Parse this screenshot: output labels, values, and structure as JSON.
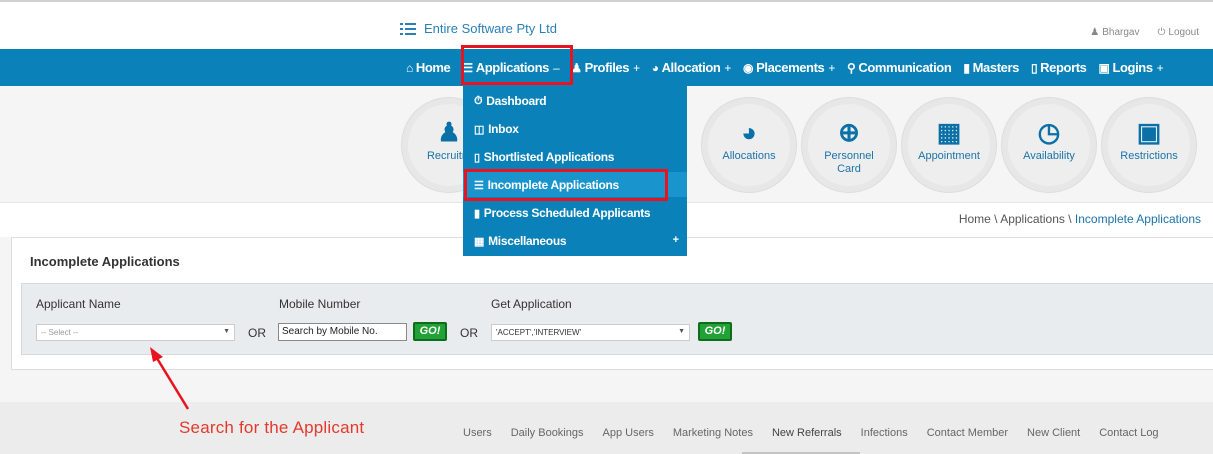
{
  "header": {
    "brand": "Entire Software Pty Ltd",
    "user": "Bhargav",
    "logout": "Logout"
  },
  "nav": {
    "items": [
      {
        "label": "Home",
        "icon": "home-icon",
        "sign": ""
      },
      {
        "label": "Applications",
        "icon": "list-icon",
        "sign": "–"
      },
      {
        "label": "Profiles",
        "icon": "user-icon",
        "sign": "+"
      },
      {
        "label": "Allocation",
        "icon": "pie-chart-icon",
        "sign": "+"
      },
      {
        "label": "Placements",
        "icon": "globe-icon",
        "sign": "+"
      },
      {
        "label": "Communication",
        "icon": "chat-icon",
        "sign": ""
      },
      {
        "label": "Masters",
        "icon": "folder-icon",
        "sign": ""
      },
      {
        "label": "Reports",
        "icon": "folder-open-icon",
        "sign": ""
      },
      {
        "label": "Logins",
        "icon": "lock-icon",
        "sign": "+"
      }
    ]
  },
  "dropdown": {
    "items": [
      {
        "label": "Dashboard",
        "icon": "dashboard-icon"
      },
      {
        "label": "Inbox",
        "icon": "inbox-icon"
      },
      {
        "label": "Shortlisted Applications",
        "icon": "folder-open-icon"
      },
      {
        "label": "Incomplete Applications",
        "icon": "list-icon"
      },
      {
        "label": "Process Scheduled Applicants",
        "icon": "file-icon"
      },
      {
        "label": "Miscellaneous",
        "icon": "table-icon"
      }
    ],
    "plus": "+"
  },
  "tiles": [
    {
      "label": "Recruitm",
      "label2": "",
      "icon": "user-card-icon"
    },
    {
      "label": "Allocations",
      "label2": "",
      "icon": "pie-chart-icon"
    },
    {
      "label": "Personnel",
      "label2": "Card",
      "icon": "search-plus-icon"
    },
    {
      "label": "Appointment",
      "label2": "",
      "icon": "calendar-icon"
    },
    {
      "label": "Availability",
      "label2": "",
      "icon": "clock-icon"
    },
    {
      "label": "Restrictions",
      "label2": "",
      "icon": "lock-icon"
    }
  ],
  "breadcrumb": {
    "home": "Home",
    "sep1": " \\ ",
    "section": "Applications",
    "sep2": " \\ ",
    "current": "Incomplete Applications"
  },
  "panel": {
    "title": "Incomplete Applications",
    "applicant_label": "Applicant Name",
    "applicant_placeholder": "-- Select --",
    "or1": "OR",
    "mobile_label": "Mobile Number",
    "mobile_placeholder": "Search by Mobile No.",
    "go1": "GO!",
    "or2": "OR",
    "get_label": "Get Application",
    "get_value": "'ACCEPT','INTERVIEW'",
    "go2": "GO!"
  },
  "annotation": "Search for the Applicant",
  "footer": {
    "links": [
      "Users",
      "Daily Bookings",
      "App Users",
      "Marketing Notes",
      "New Referrals",
      "Infections",
      "Contact Member",
      "New Client",
      "Contact Log"
    ]
  },
  "colors": {
    "nav_bg": "#0a82b9",
    "highlight": "#e8131f",
    "go_green": "#22a236"
  }
}
